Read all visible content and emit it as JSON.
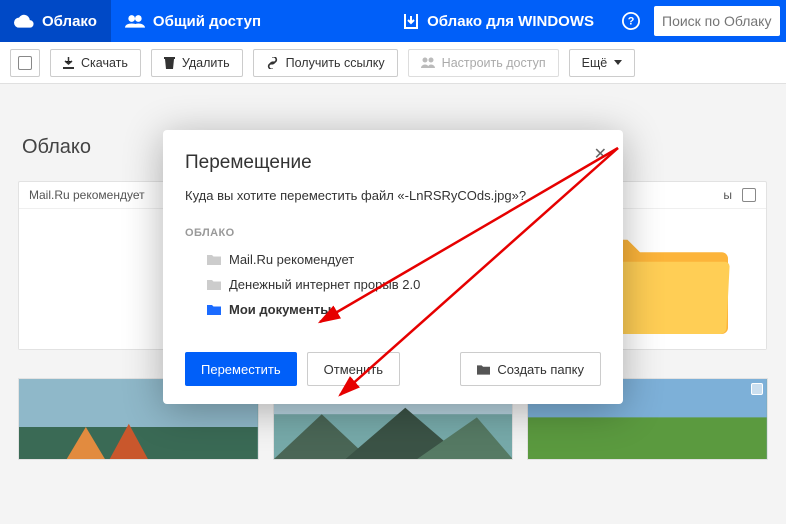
{
  "nav": {
    "cloud": "Облако",
    "shared": "Общий доступ",
    "windows": "Облако для WINDOWS"
  },
  "search": {
    "placeholder": "Поиск по Облаку"
  },
  "toolbar": {
    "download": "Скачать",
    "delete": "Удалить",
    "get_link": "Получить ссылку",
    "configure_access": "Настроить доступ",
    "more": "Ещё"
  },
  "section_title": "Облако",
  "cards": {
    "recommend": "Mail.Ru рекомендует",
    "other_tail": "ы"
  },
  "modal": {
    "title": "Перемещение",
    "question_prefix": "Куда вы хотите переместить файл «",
    "question_file": "-LnRSRyCOds.jpg",
    "question_suffix": "»?",
    "section": "ОБЛАКО",
    "tree": {
      "item0": "Mail.Ru рекомендует",
      "item1": "Денежный интернет прорыв 2.0",
      "item2": "Мои документы"
    },
    "move": "Переместить",
    "cancel": "Отменить",
    "create_folder": "Создать папку"
  }
}
